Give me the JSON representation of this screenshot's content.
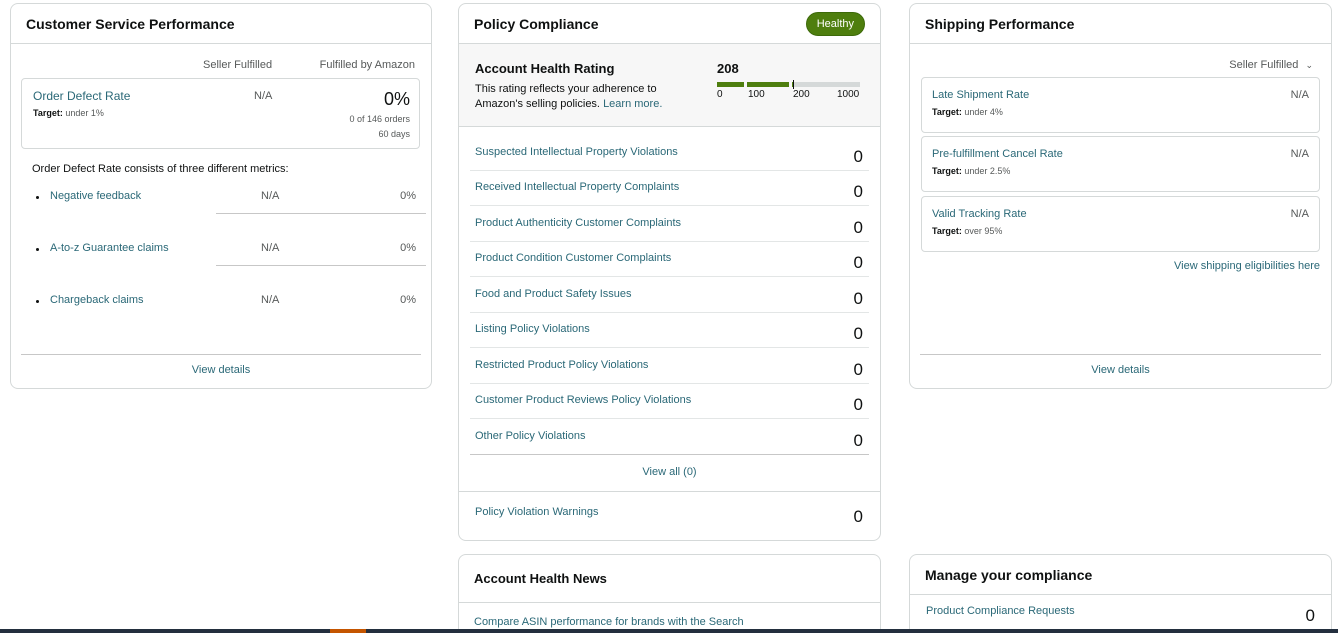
{
  "customer_service": {
    "title": "Customer Service Performance",
    "col_seller": "Seller Fulfilled",
    "col_amazon": "Fulfilled by Amazon",
    "odr": {
      "name": "Order Defect Rate",
      "target_label": "Target:",
      "target_value": "under 1%",
      "seller_value": "N/A",
      "amazon_value": "0%",
      "orders": "0 of 146 orders",
      "period": "60 days"
    },
    "consists_text": "Order Defect Rate consists of three different metrics:",
    "metrics": [
      {
        "name": "Negative feedback",
        "seller": "N/A",
        "amazon": "0%"
      },
      {
        "name": "A-to-z Guarantee claims",
        "seller": "N/A",
        "amazon": "0%"
      },
      {
        "name": "Chargeback claims",
        "seller": "N/A",
        "amazon": "0%"
      }
    ],
    "view_details": "View details"
  },
  "policy": {
    "title": "Policy Compliance",
    "badge": "Healthy",
    "ahr_title": "Account Health Rating",
    "ahr_desc": "This rating reflects your adherence to Amazon's selling policies.",
    "ahr_learn": "Learn more.",
    "ahr_score": "208",
    "ahr_score_fraction": 0.208,
    "ticks": [
      "0",
      "100",
      "200",
      "1000"
    ],
    "rows": [
      {
        "name": "Suspected Intellectual Property Violations",
        "value": "0"
      },
      {
        "name": "Received Intellectual Property Complaints",
        "value": "0"
      },
      {
        "name": "Product Authenticity Customer Complaints",
        "value": "0"
      },
      {
        "name": "Product Condition Customer Complaints",
        "value": "0"
      },
      {
        "name": "Food and Product Safety Issues",
        "value": "0"
      },
      {
        "name": "Listing Policy Violations",
        "value": "0"
      },
      {
        "name": "Restricted Product Policy Violations",
        "value": "0"
      },
      {
        "name": "Customer Product Reviews Policy Violations",
        "value": "0"
      },
      {
        "name": "Other Policy Violations",
        "value": "0"
      }
    ],
    "view_all": "View all (0)",
    "warnings_name": "Policy Violation Warnings",
    "warnings_value": "0"
  },
  "news": {
    "title": "Account Health News",
    "link": "Compare ASIN performance for brands with the Search"
  },
  "shipping": {
    "title": "Shipping Performance",
    "filter": "Seller Fulfilled",
    "metrics": [
      {
        "name": "Late Shipment Rate",
        "target_label": "Target:",
        "target_value": "under 4%",
        "value": "N/A"
      },
      {
        "name": "Pre-fulfillment Cancel Rate",
        "target_label": "Target:",
        "target_value": "under 2.5%",
        "value": "N/A"
      },
      {
        "name": "Valid Tracking Rate",
        "target_label": "Target:",
        "target_value": "over 95%",
        "value": "N/A"
      }
    ],
    "eligibilities": "View shipping eligibilities here",
    "view_details": "View details"
  },
  "manage": {
    "title": "Manage your compliance",
    "link": "Product Compliance Requests",
    "value": "0"
  },
  "colors": {
    "accent_green": "#4e7e0e",
    "link": "#2a6877"
  }
}
